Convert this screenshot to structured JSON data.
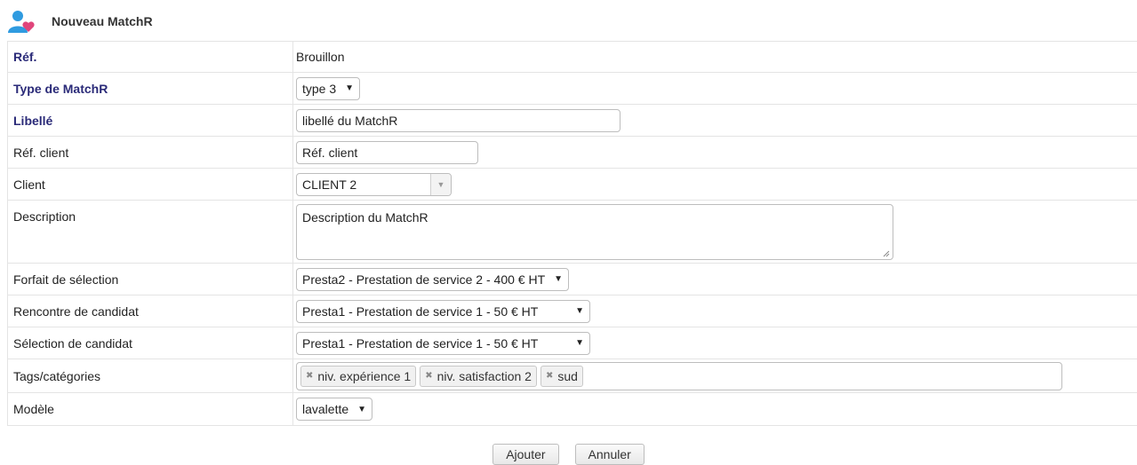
{
  "header": {
    "title": "Nouveau MatchR",
    "icon": "user-heart-icon"
  },
  "form": {
    "ref": {
      "label": "Réf.",
      "value": "Brouillon"
    },
    "type": {
      "label": "Type de MatchR",
      "value": "type 3"
    },
    "libelle": {
      "label": "Libellé",
      "value": "libellé du MatchR"
    },
    "ref_client": {
      "label": "Réf. client",
      "value": "Réf. client"
    },
    "client": {
      "label": "Client",
      "value": "CLIENT 2"
    },
    "description": {
      "label": "Description",
      "value": "Description du MatchR"
    },
    "forfait": {
      "label": "Forfait de sélection",
      "value": "Presta2 - Prestation de service 2 - 400 € HT"
    },
    "rencontre": {
      "label": "Rencontre de candidat",
      "value": "Presta1 - Prestation de service 1 - 50 € HT"
    },
    "selection": {
      "label": "Sélection de candidat",
      "value": "Presta1 - Prestation de service 1 - 50 € HT"
    },
    "tags": {
      "label": "Tags/catégories",
      "items": [
        "niv. expérience 1",
        "niv. satisfaction 2",
        "sud"
      ]
    },
    "modele": {
      "label": "Modèle",
      "value": "lavalette"
    }
  },
  "buttons": {
    "add": "Ajouter",
    "cancel": "Annuler"
  },
  "colors": {
    "required_label": "#2a2a78",
    "border": "#e4e4e4",
    "icon_blue": "#2f9be0",
    "icon_heart": "#e0457b"
  }
}
